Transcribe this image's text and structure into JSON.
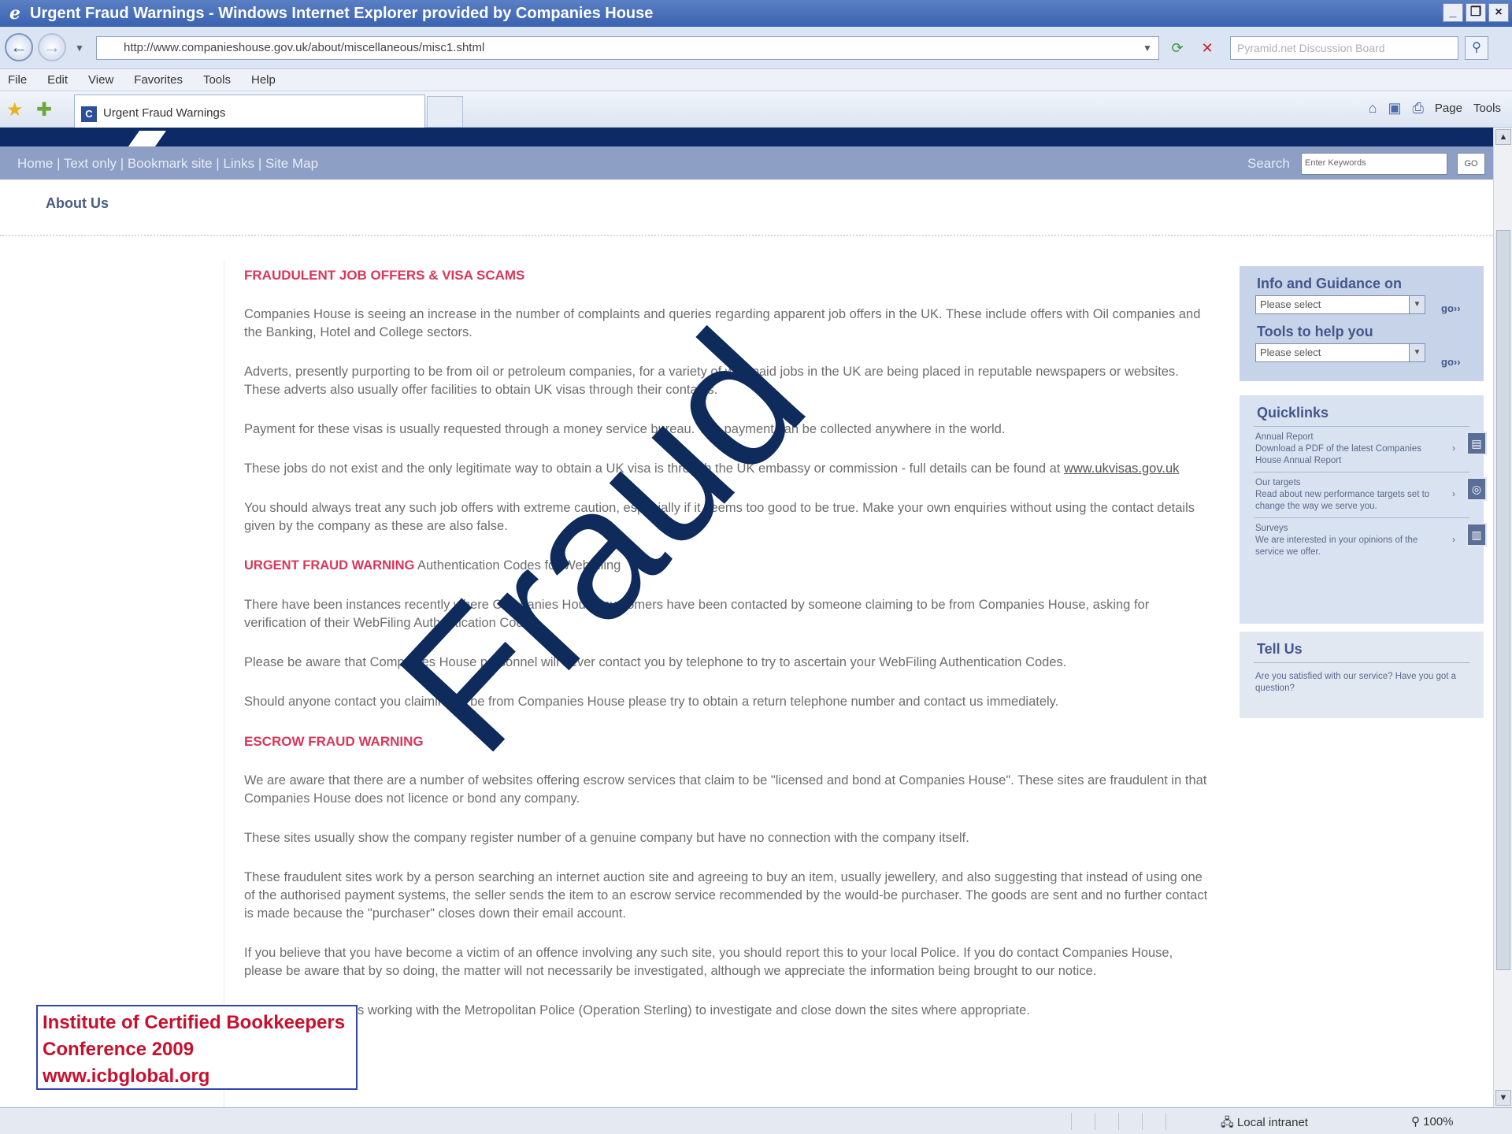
{
  "window": {
    "title": "Urgent Fraud Warnings - Windows Internet Explorer provided by Companies House",
    "min": "_",
    "max": "❐",
    "close": "×"
  },
  "address": {
    "url": "http://www.companieshouse.gov.uk/about/miscellaneous/misc1.shtml",
    "search_placeholder": "Pyramid.net Discussion Board"
  },
  "menu": [
    "File",
    "Edit",
    "View",
    "Favorites",
    "Tools",
    "Help"
  ],
  "tab": {
    "label": "Urgent Fraud Warnings"
  },
  "commandbar": {
    "page": "Page",
    "tools": "Tools"
  },
  "site": {
    "nav_links": "Home | Text only | Bookmark site | Links | Site Map",
    "search_label": "Search",
    "search_placeholder": "Enter Keywords",
    "search_go": "GO",
    "section_title": "About Us"
  },
  "article": {
    "heading1": "FRAUDULENT JOB OFFERS & VISA SCAMS",
    "p1": "Companies House is seeing an increase in the number of complaints and queries regarding apparent job offers in the UK. These include offers with Oil companies and the Banking, Hotel and College sectors.",
    "p2": "Adverts, presently purporting to be from oil or petroleum companies, for a variety of well-paid jobs in the UK are being placed in reputable newspapers or websites. These adverts also usually offer facilities to obtain UK visas through their contacts.",
    "p3": "Payment for these visas is usually requested through a money service bureau. The payment can be collected anywhere in the world.",
    "p4_start": "These jobs do not exist and the only legitimate way to obtain a UK visa is through the UK embassy or commission - full details can be found at ",
    "p4_link": "www.ukvisas.gov.uk",
    "p5": "You should always treat any such job offers with extreme caution, especially if it seems too good to be true. Make your own enquiries without using the contact details given by the company as these are also false.",
    "warn_label": "URGENT FRAUD WARNING",
    "warn_rest": " Authentication Codes for WebFiling",
    "p6": "There have been instances recently where Companies House customers have been contacted by someone claiming to be from Companies House, asking for verification of their WebFiling Authentication Codes.",
    "p7": "Please be aware that Companies House personnel will never contact you by telephone to try to ascertain your WebFiling Authentication Codes.",
    "p8": "Should anyone contact you claiming to be from Companies House please try to obtain a return telephone number and contact us immediately.",
    "heading2": "ESCROW FRAUD WARNING",
    "p9": "We are aware that there are a number of websites offering escrow services that claim to be \"licensed and bond at Companies House\". These sites are fraudulent in that Companies House does not licence or bond any company.",
    "p10": "These sites usually show the company register number of a genuine company but have no connection with the company itself.",
    "p11": "These fraudulent sites work by a person searching an internet auction site and agreeing to buy an item, usually jewellery, and also suggesting that instead of using one of the authorised payment systems, the seller sends the item to an escrow service recommended by the would-be purchaser. The goods are sent and no further contact is made because the \"purchaser\" closes down their email account.",
    "p12": "If you believe that you have become a victim of an offence involving any such site, you should report this to your local Police. If you do contact Companies House, please be aware that by so doing, the matter will not necessarily be investigated, although we appreciate the information being brought to our notice.",
    "p13": "Companies House is working with the Metropolitan Police (Operation Sterling) to investigate and close down the sites where appropriate."
  },
  "sidebar": {
    "info_title": "Info and Guidance on",
    "tools_title": "Tools to help you",
    "select_placeholder": "Please select",
    "go": "go››",
    "quicklinks_title": "Quicklinks",
    "quicklinks": [
      {
        "title": "Annual Report",
        "desc": "Download a PDF of the latest Companies House Annual Report"
      },
      {
        "title": "Our targets",
        "desc": "Read about new performance targets set to change the way we serve you."
      },
      {
        "title": "Surveys",
        "desc": "We are interested in your opinions of the service we offer."
      }
    ],
    "tell_title": "Tell Us",
    "tell_text": "Are you satisfied with our service? Have you got a question?"
  },
  "overlay": {
    "word": "Fraud",
    "color": "#0e2b5c"
  },
  "icb": {
    "line1": "Institute of Certified Bookkeepers",
    "line2": "Conference 2009",
    "line3": "www.icbglobal.org"
  },
  "status": {
    "zone": "Local intranet",
    "zoom": "100%"
  },
  "colors": {
    "site_band": "#0b2a66",
    "nav": "#8d9fc5",
    "heading_red": "#d8375a",
    "icb_red": "#c8102e"
  }
}
